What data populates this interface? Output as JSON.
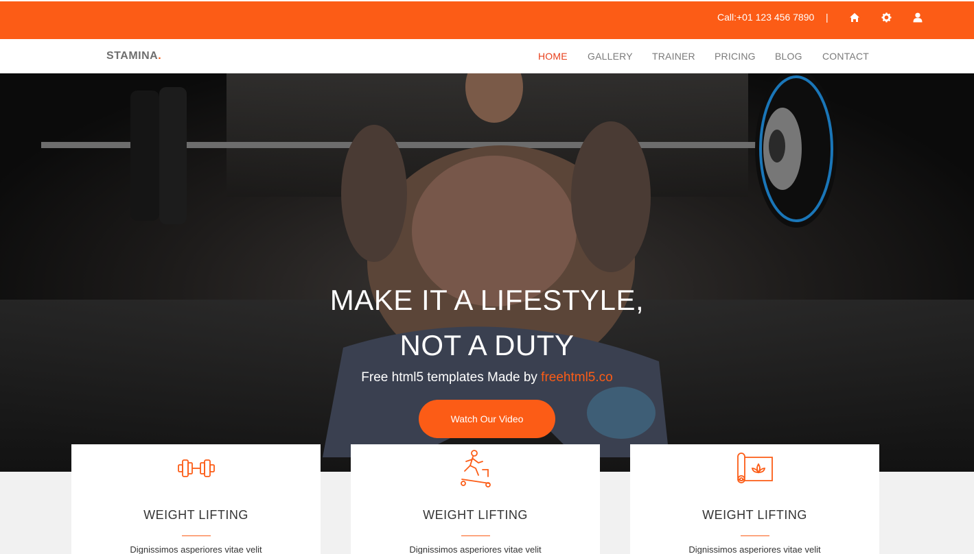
{
  "topbar": {
    "call": "Call:+01 123 456 7890",
    "separator": "|",
    "icons": [
      "home-icon",
      "gear-icon",
      "user-icon"
    ]
  },
  "nav": {
    "brand": "STAMINA",
    "brand_dot": ".",
    "items": [
      "HOME",
      "GALLERY",
      "TRAINER",
      "PRICING",
      "BLOG",
      "CONTACT"
    ],
    "active": "HOME"
  },
  "hero": {
    "title_line1": "MAKE IT A LIFESTYLE,",
    "title_line2": "NOT A DUTY",
    "subtitle_prefix": "Free html5 templates Made by ",
    "subtitle_link": "freehtml5.co",
    "button": "Watch Our Video"
  },
  "cards": [
    {
      "icon": "dumbbell-icon",
      "title": "WEIGHT LIFTING",
      "text": "Dignissimos asperiores vitae velit"
    },
    {
      "icon": "treadmill-icon",
      "title": "WEIGHT LIFTING",
      "text": "Dignissimos asperiores vitae velit"
    },
    {
      "icon": "yoga-mat-icon",
      "title": "WEIGHT LIFTING",
      "text": "Dignissimos asperiores vitae velit"
    }
  ],
  "colors": {
    "accent": "#fc5c16",
    "active_nav": "#e8401c",
    "text": "#333333"
  }
}
